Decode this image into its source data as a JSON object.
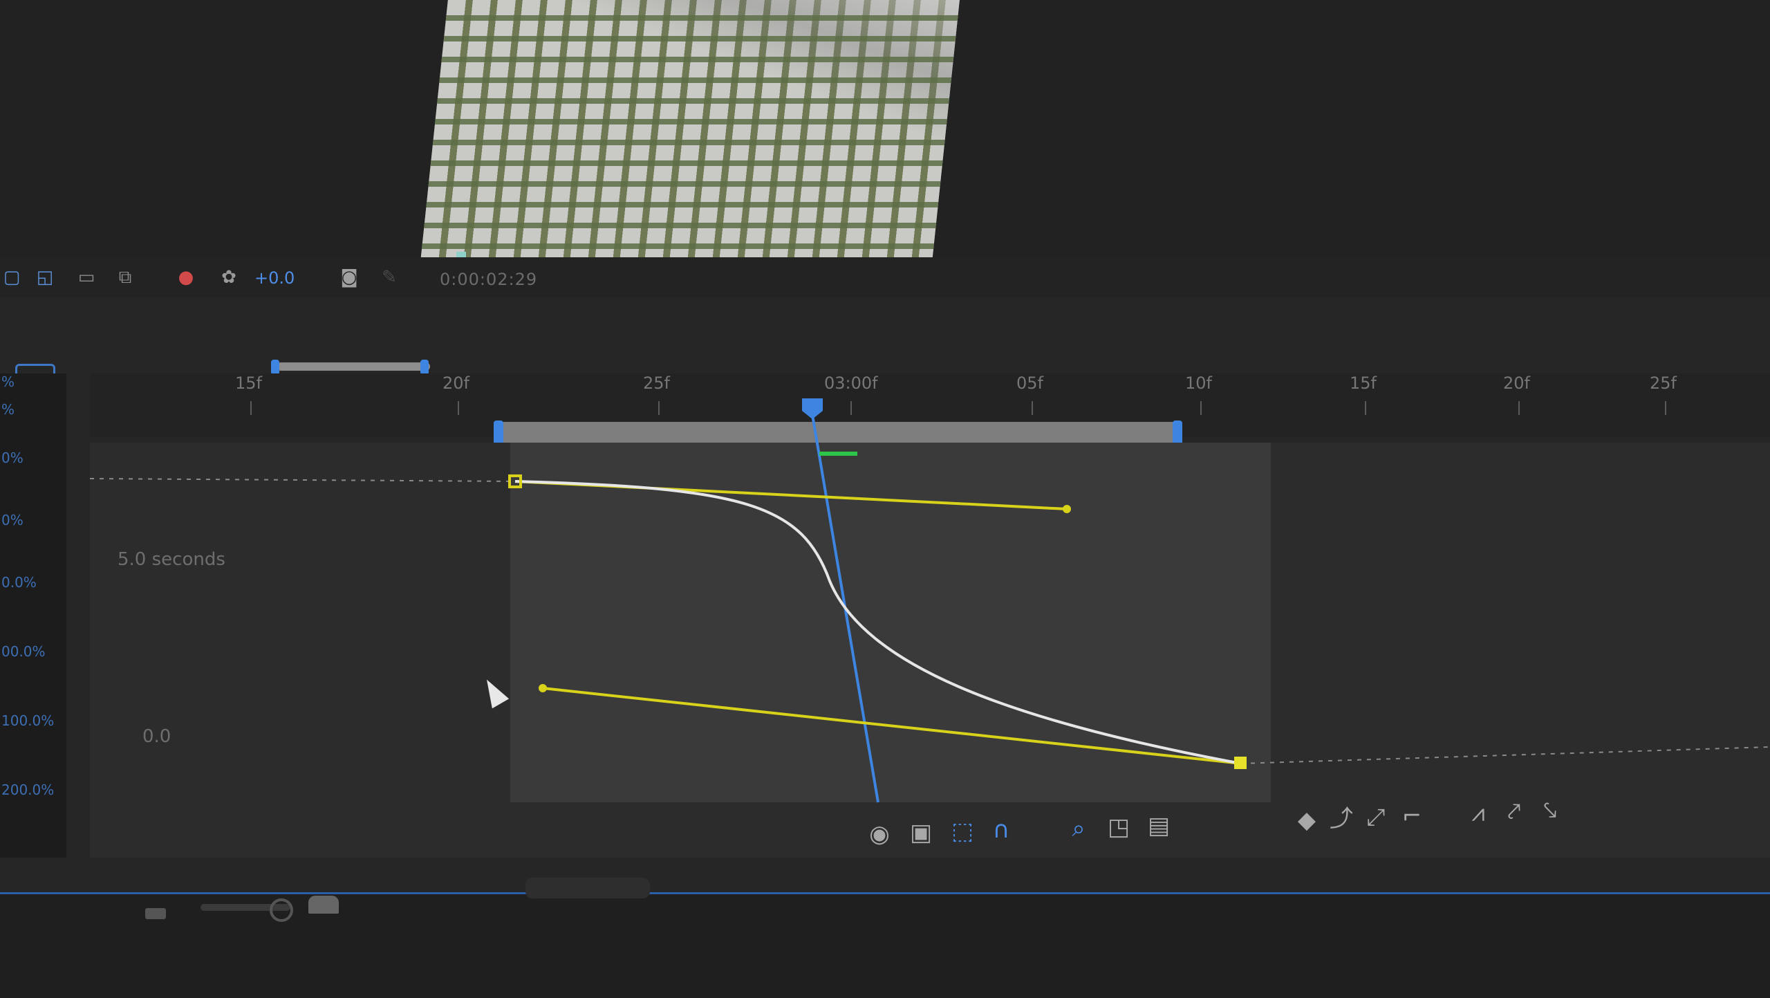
{
  "viewer": {
    "exposure": "+0.0",
    "timecode": "0:00:02:29"
  },
  "ruler": {
    "ticks": [
      "15f",
      "20f",
      "25f",
      "03:00f",
      "05f",
      "10f",
      "15f",
      "20f",
      "25f"
    ],
    "playhead_label": "03:00f"
  },
  "graph": {
    "duration_label": "5.0 seconds",
    "baseline_label": "0.0",
    "curve_color": "#e6e6e6",
    "handle_color": "#d8d21a",
    "playhead_color": "#3d85e0",
    "accent_color": "#3d85e0"
  },
  "left_strip": {
    "labels": [
      "%",
      "%",
      "0%",
      "0%",
      "0.0%",
      "00.0%",
      "100.0%",
      "200.0%"
    ]
  },
  "toolbar": {
    "icons": [
      "eye-icon",
      "graph-type-icon",
      "transform-box-icon",
      "snap-icon",
      "fit-selection-icon",
      "fit-all-icon",
      "auto-zoom-icon",
      "edit-keyframe-icon",
      "convert-hold-icon",
      "convert-auto-bezier-icon",
      "separate-dimensions-icon",
      "easy-ease-icon",
      "easy-ease-in-icon",
      "easy-ease-out-icon"
    ]
  }
}
